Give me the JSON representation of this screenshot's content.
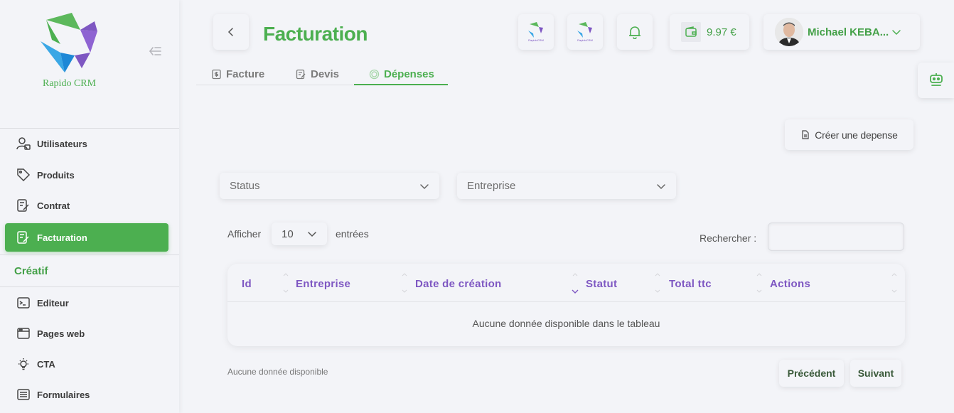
{
  "brand": {
    "name": "Rapido CRM"
  },
  "sidebar": {
    "items": [
      {
        "label": "Utilisateurs",
        "icon": "user-lock-icon"
      },
      {
        "label": "Produits",
        "icon": "tag-icon"
      },
      {
        "label": "Contrat",
        "icon": "contract-icon"
      },
      {
        "label": "Facturation",
        "icon": "invoice-icon",
        "active": true
      }
    ],
    "section_title": "Créatif",
    "creative_items": [
      {
        "label": "Editeur",
        "icon": "terminal-icon"
      },
      {
        "label": "Pages web",
        "icon": "browser-icon"
      },
      {
        "label": "CTA",
        "icon": "lightbulb-icon"
      },
      {
        "label": "Formulaires",
        "icon": "form-icon"
      }
    ]
  },
  "header": {
    "title": "Facturation",
    "wallet_amount": "9.97 €",
    "user_name": "Michael KEBA...",
    "app_icon_caption": "RapidoCRM"
  },
  "tabs": [
    {
      "label": "Facture",
      "icon": "invoice-icon"
    },
    {
      "label": "Devis",
      "icon": "edit-doc-icon"
    },
    {
      "label": "Dépenses",
      "icon": "coin-icon",
      "active": true
    }
  ],
  "create_button": {
    "label": "Créer une depense"
  },
  "filters": {
    "status_placeholder": "Status",
    "company_placeholder": "Entreprise"
  },
  "table_controls": {
    "show_label": "Afficher",
    "page_length": "10",
    "entries_label": "entrées",
    "search_label": "Rechercher :"
  },
  "table": {
    "columns": [
      "Id",
      "Entreprise",
      "Date de création",
      "Statut",
      "Total ttc",
      "Actions"
    ],
    "empty_message": "Aucune donnée disponible dans le tableau"
  },
  "pagination": {
    "info": "Aucune donnée disponible",
    "prev": "Précédent",
    "next": "Suivant"
  },
  "colors": {
    "accent": "#4caf50",
    "header_text": "#7e57c2",
    "background": "#f3f4f8"
  }
}
